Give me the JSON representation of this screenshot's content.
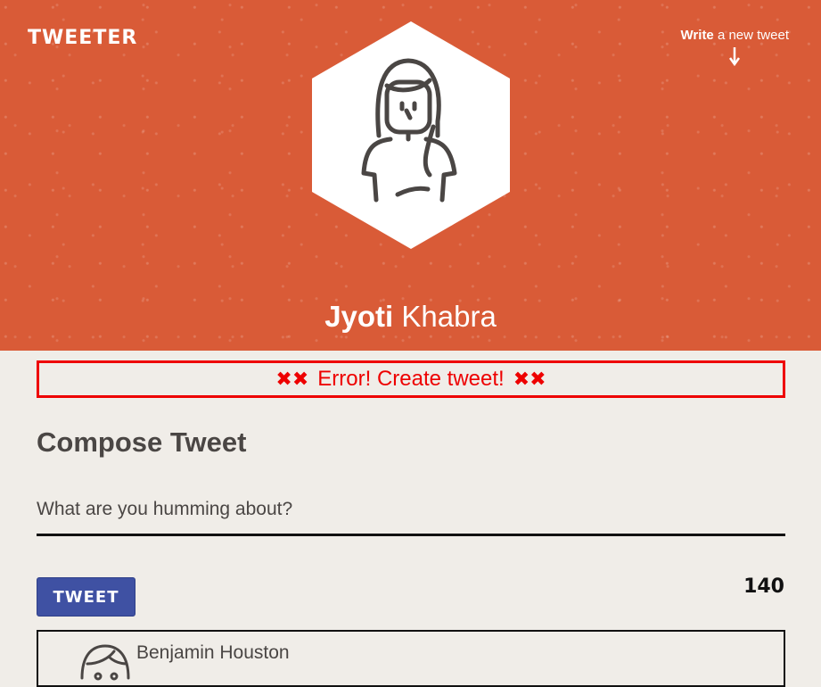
{
  "header": {
    "logo": "TWEETER",
    "write_link": {
      "bold": "Write",
      "rest": " a new tweet"
    },
    "profile": {
      "first_name": "Jyoti",
      "last_name": "Khabra"
    }
  },
  "error": {
    "message": "Error! Create tweet!",
    "symbol": "✖✖"
  },
  "compose": {
    "title": "Compose Tweet",
    "placeholder": "What are you humming about?",
    "button_label": "Tweet",
    "char_count": "140"
  },
  "tweets": [
    {
      "author": "Benjamin Houston"
    }
  ],
  "colors": {
    "header_bg": "#d95b37",
    "page_bg": "#f0ede8",
    "error": "#ee0000",
    "button": "#3f51a3",
    "text": "#4a4644"
  }
}
